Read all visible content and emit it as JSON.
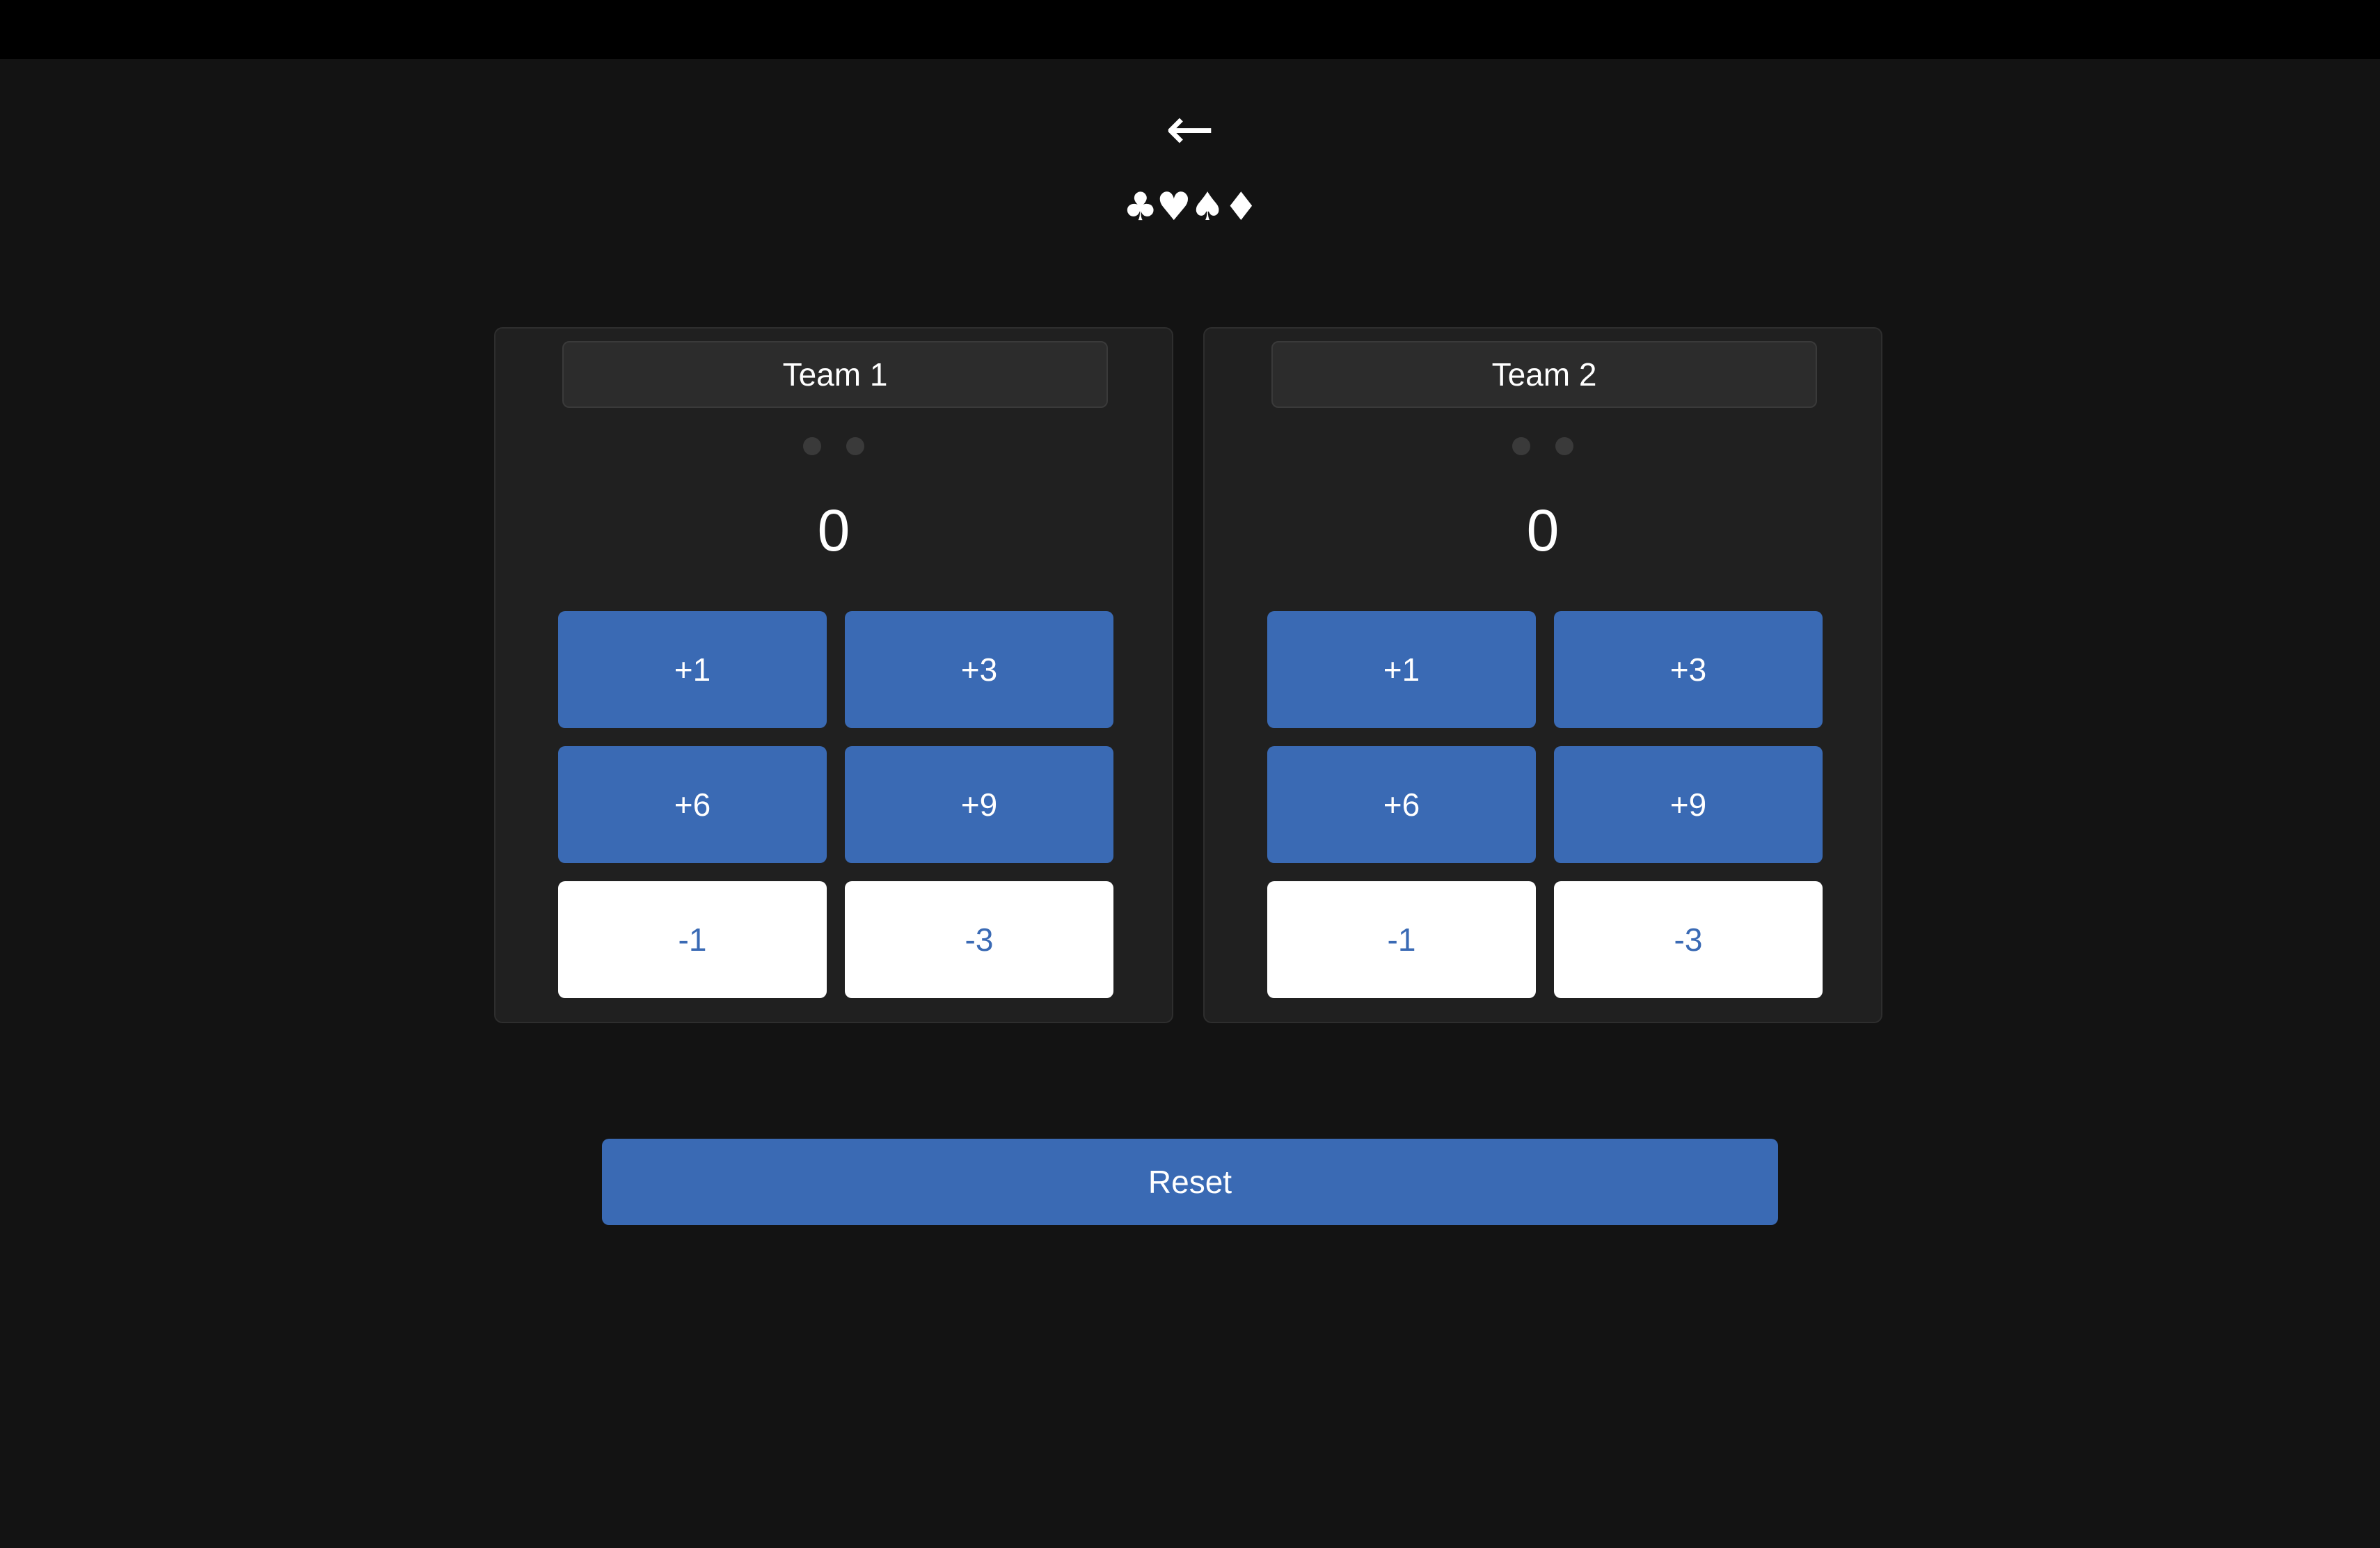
{
  "header": {
    "back_icon": "←",
    "suits": "♣♥♠♦"
  },
  "teams": [
    {
      "name": "Team 1",
      "score": "0",
      "buttons": {
        "plus1": "+1",
        "plus3": "+3",
        "plus6": "+6",
        "plus9": "+9",
        "minus1": "-1",
        "minus3": "-3"
      }
    },
    {
      "name": "Team 2",
      "score": "0",
      "buttons": {
        "plus1": "+1",
        "plus3": "+3",
        "plus6": "+6",
        "plus9": "+9",
        "minus1": "-1",
        "minus3": "-3"
      }
    }
  ],
  "reset_label": "Reset",
  "colors": {
    "background": "#131313",
    "panel": "#202020",
    "accent_blue": "#3a6ab4",
    "secondary_button": "#ffffff"
  }
}
